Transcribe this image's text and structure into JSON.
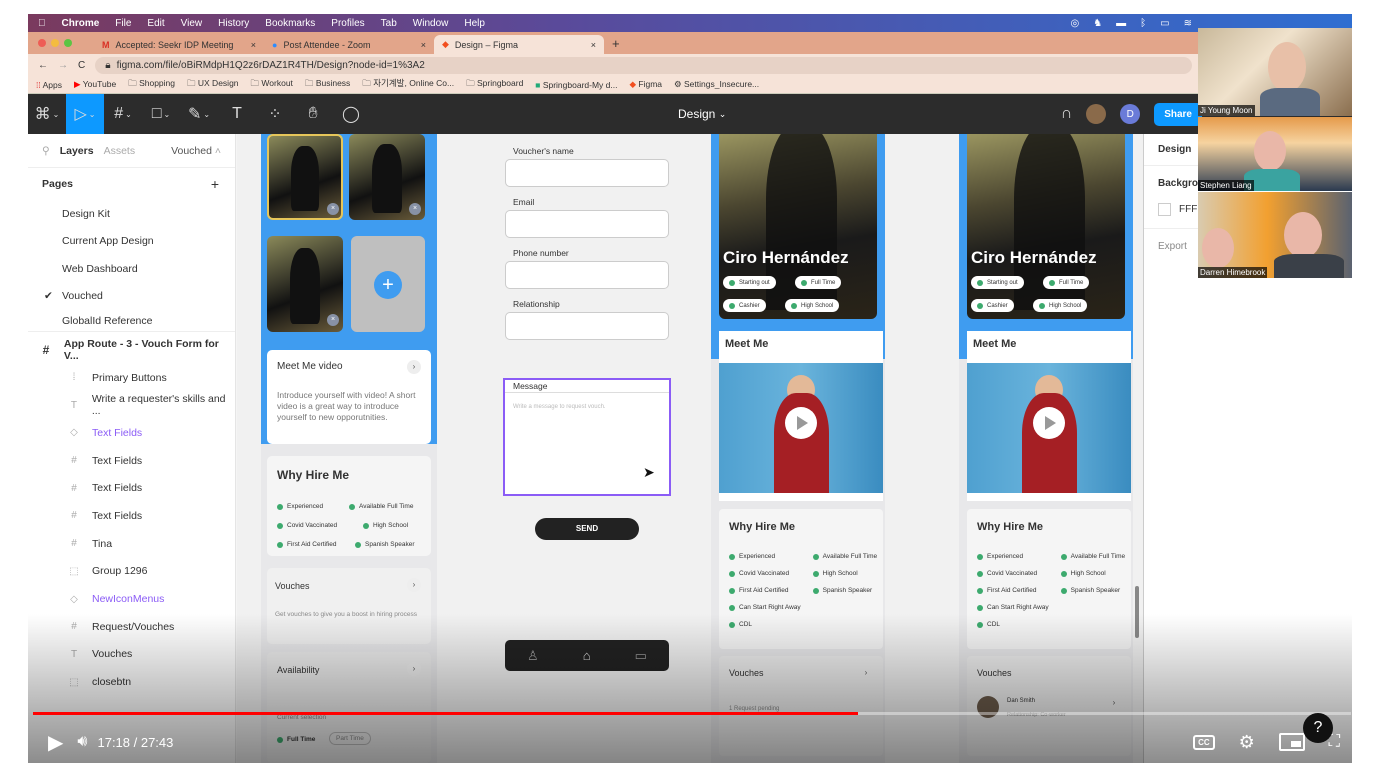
{
  "macos_menu": {
    "app": "Chrome",
    "items": [
      "File",
      "Edit",
      "View",
      "History",
      "Bookmarks",
      "Profiles",
      "Tab",
      "Window",
      "Help"
    ]
  },
  "browser": {
    "tabs": [
      {
        "label": "Accepted: Seekr IDP Meeting",
        "icon": "gmail-icon",
        "active": false
      },
      {
        "label": "Post Attendee - Zoom",
        "icon": "zoom-icon",
        "active": false
      },
      {
        "label": "Design – Figma",
        "icon": "figma-icon",
        "active": true
      }
    ],
    "url": "figma.com/file/oBiRMdpH1Q2z6rDAZ1R4TH/Design?node-id=1%3A2",
    "bookmarks": [
      "Apps",
      "YouTube",
      "Shopping",
      "UX Design",
      "Workout",
      "Business",
      "자기계발, Online Co...",
      "Springboard",
      "Springboard-My d...",
      "Figma",
      "Settings_Insecure..."
    ]
  },
  "figma": {
    "doc_title": "Design",
    "share_label": "Share",
    "user_initial": "D",
    "left_panel": {
      "tabs": {
        "layers": "Layers",
        "assets": "Assets",
        "page_selector": "Vouched"
      },
      "pages_heading": "Pages",
      "pages": [
        {
          "label": "Design Kit",
          "selected": false
        },
        {
          "label": "Current App Design",
          "selected": false
        },
        {
          "label": "Web Dashboard",
          "selected": false
        },
        {
          "label": "Vouched",
          "selected": true
        },
        {
          "label": "GlobalId Reference",
          "selected": false
        }
      ],
      "layers": [
        {
          "label": "App Route - 3 - Vouch Form for V...",
          "icon": "frame-icon",
          "top": true
        },
        {
          "label": "Primary Buttons",
          "icon": "component-bars-icon"
        },
        {
          "label": "Write a requester's skills and ...",
          "icon": "text-icon"
        },
        {
          "label": "Text Fields",
          "icon": "instance-icon",
          "purple": true
        },
        {
          "label": "Text Fields",
          "icon": "frame-icon"
        },
        {
          "label": "Text Fields",
          "icon": "frame-icon"
        },
        {
          "label": "Text Fields",
          "icon": "frame-icon"
        },
        {
          "label": "Tina",
          "icon": "frame-icon"
        },
        {
          "label": "Group 1296",
          "icon": "group-icon"
        },
        {
          "label": "NewIconMenus",
          "icon": "instance-icon",
          "purple": true
        },
        {
          "label": "Request/Vouches",
          "icon": "frame-icon"
        },
        {
          "label": "Vouches",
          "icon": "text-icon"
        },
        {
          "label": "closebtn",
          "icon": "group-icon"
        }
      ]
    },
    "canvas": {
      "profile_edit": {
        "meet_me_video": {
          "title": "Meet Me video",
          "body": "Introduce yourself with video! A short video is a great way to introduce yourself to new opporutnities."
        },
        "why_hire_me": {
          "title": "Why Hire Me",
          "tags": [
            "Experienced",
            "Available Full Time",
            "Covid Vaccinated",
            "High School",
            "First Aid Certified",
            "Spanish Speaker"
          ]
        },
        "vouches": {
          "title": "Vouches",
          "body": "Get vouches to give you a boost in hiring process"
        },
        "availability": {
          "title": "Availability",
          "subtitle": "Current selection",
          "options": [
            "Full Time",
            "Part Time"
          ]
        }
      },
      "vouch_form": {
        "fields": [
          {
            "label": "Voucher's name",
            "value": ""
          },
          {
            "label": "Email",
            "value": ""
          },
          {
            "label": "Phone number",
            "value": ""
          },
          {
            "label": "Relationship",
            "value": ""
          }
        ],
        "message": {
          "label": "Message",
          "placeholder": "Write a message to request vouch."
        },
        "send_label": "SEND"
      },
      "profiles": [
        {
          "name": "Ciro Hernández",
          "pills": [
            "Starting out",
            "Full Time",
            "Cashier",
            "High School"
          ],
          "meet_me": "Meet Me",
          "why_title": "Why Hire Me",
          "why_tags": [
            "Experienced",
            "Available Full Time",
            "Covid Vaccinated",
            "High School",
            "First Aid Certified",
            "Spanish Speaker",
            "Can Start Right Away",
            "CDL"
          ],
          "vouches_title": "Vouches",
          "vouches_sub": "1 Request pending"
        },
        {
          "name": "Ciro Hernández",
          "pills": [
            "Starting out",
            "Full Time",
            "Cashier",
            "High School"
          ],
          "meet_me": "Meet Me",
          "why_title": "Why Hire Me",
          "why_tags": [
            "Experienced",
            "Available Full Time",
            "Covid Vaccinated",
            "High School",
            "First Aid Certified",
            "Spanish Speaker",
            "Can Start Right Away",
            "CDL"
          ],
          "vouches_title": "Vouches",
          "voucher": {
            "name": "Dan Smith",
            "relationship": "Relationship: Co-worker"
          }
        }
      ]
    },
    "right_panel": {
      "tab": "Design",
      "background_label": "Backgro",
      "background_value": "FFF",
      "export_label": "Export"
    }
  },
  "zoom_participants": [
    "Ji Young Moon",
    "Stephen Liang",
    "Darren Himebrook"
  ],
  "player": {
    "current": "17:18",
    "total": "27:43",
    "time_display": "17:18 / 27:43",
    "progress_pct": 62.6
  }
}
